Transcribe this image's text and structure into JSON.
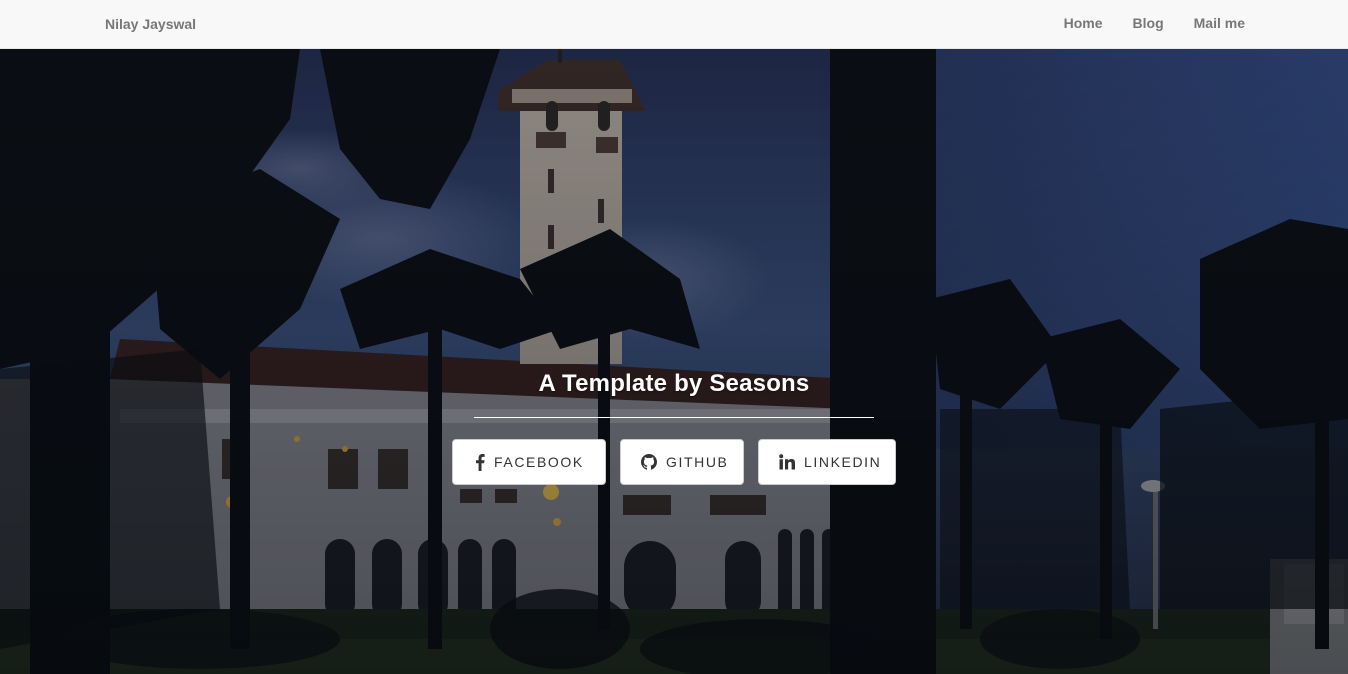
{
  "navbar": {
    "brand": "Nilay Jayswal",
    "links": [
      "Home",
      "Blog",
      "Mail me"
    ]
  },
  "hero": {
    "title": "A Template by Seasons",
    "buttons": [
      {
        "label": "FACEBOOK",
        "icon": "facebook-icon"
      },
      {
        "label": "GITHUB",
        "icon": "github-icon"
      },
      {
        "label": "LINKEDIN",
        "icon": "linkedin-icon"
      }
    ]
  },
  "colors": {
    "navbar_bg": "#f8f8f8",
    "nav_text": "#777777",
    "hero_text": "#ffffff",
    "button_bg": "#ffffff",
    "button_text": "#333333"
  }
}
